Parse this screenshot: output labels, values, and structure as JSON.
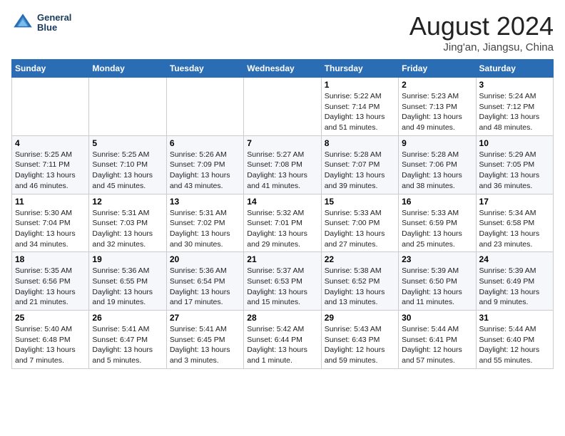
{
  "header": {
    "logo_line1": "General",
    "logo_line2": "Blue",
    "month_title": "August 2024",
    "location": "Jing'an, Jiangsu, China"
  },
  "weekdays": [
    "Sunday",
    "Monday",
    "Tuesday",
    "Wednesday",
    "Thursday",
    "Friday",
    "Saturday"
  ],
  "weeks": [
    [
      {
        "day": "",
        "info": ""
      },
      {
        "day": "",
        "info": ""
      },
      {
        "day": "",
        "info": ""
      },
      {
        "day": "",
        "info": ""
      },
      {
        "day": "1",
        "info": "Sunrise: 5:22 AM\nSunset: 7:14 PM\nDaylight: 13 hours\nand 51 minutes."
      },
      {
        "day": "2",
        "info": "Sunrise: 5:23 AM\nSunset: 7:13 PM\nDaylight: 13 hours\nand 49 minutes."
      },
      {
        "day": "3",
        "info": "Sunrise: 5:24 AM\nSunset: 7:12 PM\nDaylight: 13 hours\nand 48 minutes."
      }
    ],
    [
      {
        "day": "4",
        "info": "Sunrise: 5:25 AM\nSunset: 7:11 PM\nDaylight: 13 hours\nand 46 minutes."
      },
      {
        "day": "5",
        "info": "Sunrise: 5:25 AM\nSunset: 7:10 PM\nDaylight: 13 hours\nand 45 minutes."
      },
      {
        "day": "6",
        "info": "Sunrise: 5:26 AM\nSunset: 7:09 PM\nDaylight: 13 hours\nand 43 minutes."
      },
      {
        "day": "7",
        "info": "Sunrise: 5:27 AM\nSunset: 7:08 PM\nDaylight: 13 hours\nand 41 minutes."
      },
      {
        "day": "8",
        "info": "Sunrise: 5:28 AM\nSunset: 7:07 PM\nDaylight: 13 hours\nand 39 minutes."
      },
      {
        "day": "9",
        "info": "Sunrise: 5:28 AM\nSunset: 7:06 PM\nDaylight: 13 hours\nand 38 minutes."
      },
      {
        "day": "10",
        "info": "Sunrise: 5:29 AM\nSunset: 7:05 PM\nDaylight: 13 hours\nand 36 minutes."
      }
    ],
    [
      {
        "day": "11",
        "info": "Sunrise: 5:30 AM\nSunset: 7:04 PM\nDaylight: 13 hours\nand 34 minutes."
      },
      {
        "day": "12",
        "info": "Sunrise: 5:31 AM\nSunset: 7:03 PM\nDaylight: 13 hours\nand 32 minutes."
      },
      {
        "day": "13",
        "info": "Sunrise: 5:31 AM\nSunset: 7:02 PM\nDaylight: 13 hours\nand 30 minutes."
      },
      {
        "day": "14",
        "info": "Sunrise: 5:32 AM\nSunset: 7:01 PM\nDaylight: 13 hours\nand 29 minutes."
      },
      {
        "day": "15",
        "info": "Sunrise: 5:33 AM\nSunset: 7:00 PM\nDaylight: 13 hours\nand 27 minutes."
      },
      {
        "day": "16",
        "info": "Sunrise: 5:33 AM\nSunset: 6:59 PM\nDaylight: 13 hours\nand 25 minutes."
      },
      {
        "day": "17",
        "info": "Sunrise: 5:34 AM\nSunset: 6:58 PM\nDaylight: 13 hours\nand 23 minutes."
      }
    ],
    [
      {
        "day": "18",
        "info": "Sunrise: 5:35 AM\nSunset: 6:56 PM\nDaylight: 13 hours\nand 21 minutes."
      },
      {
        "day": "19",
        "info": "Sunrise: 5:36 AM\nSunset: 6:55 PM\nDaylight: 13 hours\nand 19 minutes."
      },
      {
        "day": "20",
        "info": "Sunrise: 5:36 AM\nSunset: 6:54 PM\nDaylight: 13 hours\nand 17 minutes."
      },
      {
        "day": "21",
        "info": "Sunrise: 5:37 AM\nSunset: 6:53 PM\nDaylight: 13 hours\nand 15 minutes."
      },
      {
        "day": "22",
        "info": "Sunrise: 5:38 AM\nSunset: 6:52 PM\nDaylight: 13 hours\nand 13 minutes."
      },
      {
        "day": "23",
        "info": "Sunrise: 5:39 AM\nSunset: 6:50 PM\nDaylight: 13 hours\nand 11 minutes."
      },
      {
        "day": "24",
        "info": "Sunrise: 5:39 AM\nSunset: 6:49 PM\nDaylight: 13 hours\nand 9 minutes."
      }
    ],
    [
      {
        "day": "25",
        "info": "Sunrise: 5:40 AM\nSunset: 6:48 PM\nDaylight: 13 hours\nand 7 minutes."
      },
      {
        "day": "26",
        "info": "Sunrise: 5:41 AM\nSunset: 6:47 PM\nDaylight: 13 hours\nand 5 minutes."
      },
      {
        "day": "27",
        "info": "Sunrise: 5:41 AM\nSunset: 6:45 PM\nDaylight: 13 hours\nand 3 minutes."
      },
      {
        "day": "28",
        "info": "Sunrise: 5:42 AM\nSunset: 6:44 PM\nDaylight: 13 hours\nand 1 minute."
      },
      {
        "day": "29",
        "info": "Sunrise: 5:43 AM\nSunset: 6:43 PM\nDaylight: 12 hours\nand 59 minutes."
      },
      {
        "day": "30",
        "info": "Sunrise: 5:44 AM\nSunset: 6:41 PM\nDaylight: 12 hours\nand 57 minutes."
      },
      {
        "day": "31",
        "info": "Sunrise: 5:44 AM\nSunset: 6:40 PM\nDaylight: 12 hours\nand 55 minutes."
      }
    ]
  ]
}
